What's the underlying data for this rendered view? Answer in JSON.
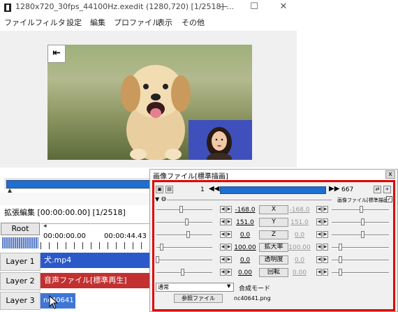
{
  "window": {
    "title": "1280x720_30fps_44100Hz.exedit (1280,720) [1/2518] ...",
    "minimize": "—",
    "maximize": "☐",
    "close": "✕"
  },
  "menu": [
    "ファイル",
    "フィルタ",
    "設定",
    "編集",
    "プロファイル",
    "表示",
    "その他"
  ],
  "preview": {
    "skip_icon": "skip-to-start-icon",
    "seek_progress": 1.0
  },
  "timeline": {
    "title": "拡張編集 [00:00:00.00] [1/2518]",
    "root_label": "Root",
    "time_start": "00:00:00.00",
    "time_mark": "00:00:44.43",
    "layers": [
      {
        "label": "Layer 1",
        "clip": "犬.mp4",
        "color": "#2b59c9"
      },
      {
        "label": "Layer 2",
        "clip": "音声ファイル[標準再生]",
        "color": "#c23030"
      },
      {
        "label": "Layer 3",
        "clip": "nc40641",
        "color": "#3f76d6"
      }
    ]
  },
  "object": {
    "title": "画像ファイル[標準描画]",
    "close": "x",
    "frame_start": "1",
    "frame_end": "667",
    "effect_name": "画像ファイル[標準描画]",
    "effect_checked": "✓",
    "params": [
      {
        "left": "-168.0",
        "name": "X",
        "right": "-168.0"
      },
      {
        "left": "151.0",
        "name": "Y",
        "right": "151.0"
      },
      {
        "left": "0.0",
        "name": "Z",
        "right": "0.0"
      },
      {
        "left": "100.00",
        "name": "拡大率",
        "right": "100.00"
      },
      {
        "left": "0.0",
        "name": "透明度",
        "right": "0.0"
      },
      {
        "left": "0.00",
        "name": "回転",
        "right": "0.00"
      }
    ],
    "blend_value": "通常",
    "blend_label": "合成モード",
    "file_button": "参照ファイル",
    "file_name": "nc40641.png",
    "highlight_color": "#e00000"
  }
}
